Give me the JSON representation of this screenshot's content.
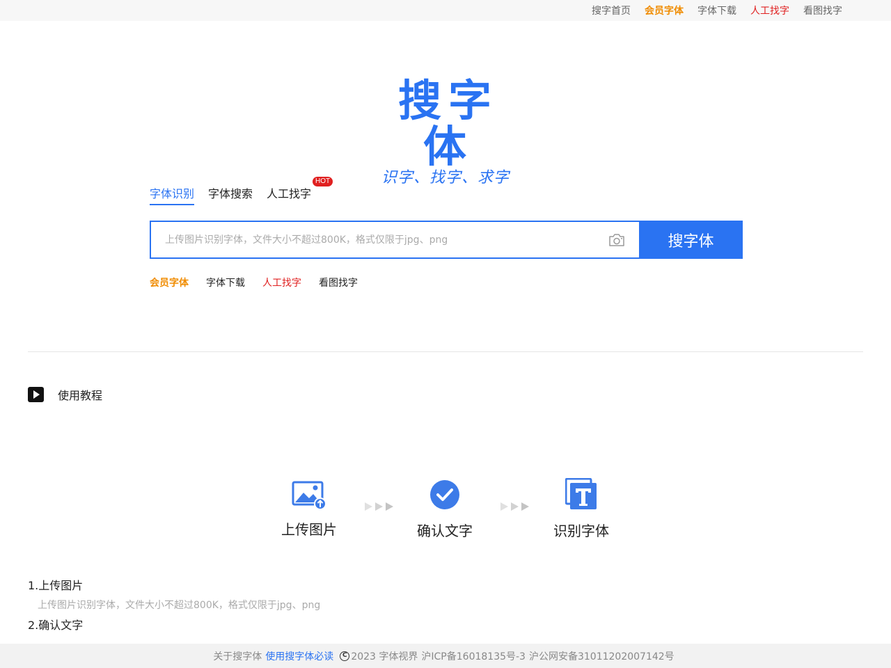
{
  "top_nav": {
    "items": [
      {
        "label": "搜字首页"
      },
      {
        "label": "会员字体"
      },
      {
        "label": "字体下载"
      },
      {
        "label": "人工找字"
      },
      {
        "label": "看图找字"
      }
    ]
  },
  "logo": {
    "title": "搜字体",
    "subtitle": "识字、找字、求字"
  },
  "search_tabs": {
    "items": [
      {
        "label": "字体识别",
        "active": true
      },
      {
        "label": "字体搜索",
        "active": false
      },
      {
        "label": "人工找字",
        "active": false
      }
    ],
    "hot_badge": "HOT"
  },
  "search": {
    "placeholder": "上传图片识别字体，文件大小不超过800K，格式仅限于jpg、png",
    "button_label": "搜字体",
    "camera_icon": "camera-icon"
  },
  "quick_links": [
    {
      "label": "会员字体"
    },
    {
      "label": "字体下载"
    },
    {
      "label": "人工找字"
    },
    {
      "label": "看图找字"
    }
  ],
  "tutorial": {
    "label": "使用教程",
    "icon": "play-icon"
  },
  "steps": [
    {
      "label": "上传图片",
      "icon": "image-upload-icon"
    },
    {
      "label": "确认文字",
      "icon": "check-circle-icon"
    },
    {
      "label": "识别字体",
      "icon": "font-t-icon"
    }
  ],
  "instructions": [
    {
      "title": "1.上传图片",
      "desc": "上传图片识别字体，文件大小不超过800K，格式仅限于jpg、png"
    },
    {
      "title": "2.确认文字",
      "desc": ""
    }
  ],
  "footer": {
    "about": "关于搜字体",
    "must_read": "使用搜字体必读",
    "copyright": "2023 字体视界",
    "icp": "沪ICP备16018135号-3",
    "police": "沪公网安备31011202007142号"
  },
  "colors": {
    "brand_blue": "#2a73f2",
    "vip_orange": "#f08c00",
    "hot_red": "#e02020"
  }
}
